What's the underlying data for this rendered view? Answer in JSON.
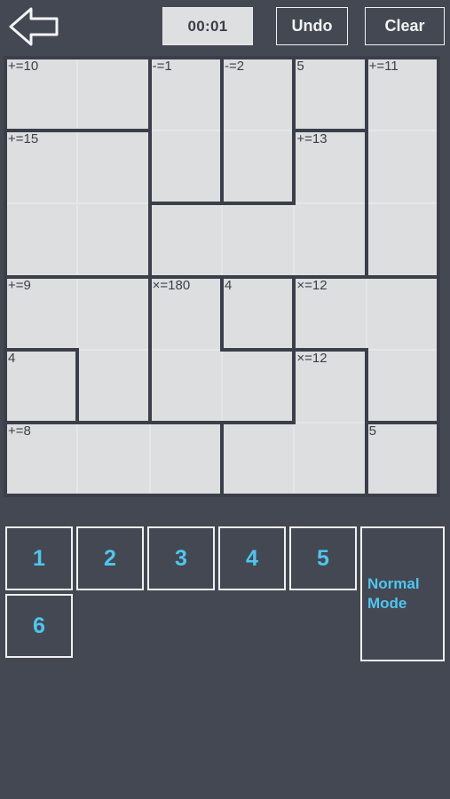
{
  "app": {
    "background_color": "#434853",
    "cell_color": "#dcdee0",
    "cage_border_color": "#3b3f49",
    "accent_color": "#4fc6ee"
  },
  "topbar": {
    "back_icon": "back-arrow-icon",
    "timer": "00:01",
    "undo_label": "Undo",
    "clear_label": "Clear"
  },
  "puzzle": {
    "size": 6,
    "rows": 6,
    "cols": 6,
    "cells": [
      {
        "r": 0,
        "c": 0,
        "clue": "+=10",
        "value": ""
      },
      {
        "r": 0,
        "c": 1,
        "clue": "",
        "value": ""
      },
      {
        "r": 0,
        "c": 2,
        "clue": "-=1",
        "value": ""
      },
      {
        "r": 0,
        "c": 3,
        "clue": "-=2",
        "value": ""
      },
      {
        "r": 0,
        "c": 4,
        "clue": "5",
        "value": ""
      },
      {
        "r": 0,
        "c": 5,
        "clue": "+=11",
        "value": ""
      },
      {
        "r": 1,
        "c": 0,
        "clue": "+=15",
        "value": ""
      },
      {
        "r": 1,
        "c": 1,
        "clue": "",
        "value": ""
      },
      {
        "r": 1,
        "c": 2,
        "clue": "",
        "value": ""
      },
      {
        "r": 1,
        "c": 3,
        "clue": "",
        "value": ""
      },
      {
        "r": 1,
        "c": 4,
        "clue": "+=13",
        "value": ""
      },
      {
        "r": 1,
        "c": 5,
        "clue": "",
        "value": ""
      },
      {
        "r": 2,
        "c": 0,
        "clue": "",
        "value": ""
      },
      {
        "r": 2,
        "c": 1,
        "clue": "",
        "value": ""
      },
      {
        "r": 2,
        "c": 2,
        "clue": "",
        "value": ""
      },
      {
        "r": 2,
        "c": 3,
        "clue": "",
        "value": ""
      },
      {
        "r": 2,
        "c": 4,
        "clue": "",
        "value": ""
      },
      {
        "r": 2,
        "c": 5,
        "clue": "",
        "value": ""
      },
      {
        "r": 3,
        "c": 0,
        "clue": "+=9",
        "value": ""
      },
      {
        "r": 3,
        "c": 1,
        "clue": "",
        "value": ""
      },
      {
        "r": 3,
        "c": 2,
        "clue": "×=180",
        "value": ""
      },
      {
        "r": 3,
        "c": 3,
        "clue": "4",
        "value": ""
      },
      {
        "r": 3,
        "c": 4,
        "clue": "×=12",
        "value": ""
      },
      {
        "r": 3,
        "c": 5,
        "clue": "",
        "value": ""
      },
      {
        "r": 4,
        "c": 0,
        "clue": "4",
        "value": ""
      },
      {
        "r": 4,
        "c": 1,
        "clue": "",
        "value": ""
      },
      {
        "r": 4,
        "c": 2,
        "clue": "",
        "value": ""
      },
      {
        "r": 4,
        "c": 3,
        "clue": "",
        "value": ""
      },
      {
        "r": 4,
        "c": 4,
        "clue": "×=12",
        "value": ""
      },
      {
        "r": 4,
        "c": 5,
        "clue": "",
        "value": ""
      },
      {
        "r": 5,
        "c": 0,
        "clue": "+=8",
        "value": ""
      },
      {
        "r": 5,
        "c": 1,
        "clue": "",
        "value": ""
      },
      {
        "r": 5,
        "c": 2,
        "clue": "",
        "value": ""
      },
      {
        "r": 5,
        "c": 3,
        "clue": "",
        "value": ""
      },
      {
        "r": 5,
        "c": 4,
        "clue": "",
        "value": ""
      },
      {
        "r": 5,
        "c": 5,
        "clue": "5",
        "value": ""
      }
    ],
    "cages": [
      {
        "clue": "+=10",
        "cells": [
          [
            0,
            0
          ],
          [
            0,
            1
          ]
        ]
      },
      {
        "clue": "-=1",
        "cells": [
          [
            0,
            2
          ],
          [
            1,
            2
          ]
        ]
      },
      {
        "clue": "-=2",
        "cells": [
          [
            0,
            3
          ],
          [
            1,
            3
          ]
        ]
      },
      {
        "clue": "5",
        "cells": [
          [
            0,
            4
          ]
        ]
      },
      {
        "clue": "+=11",
        "cells": [
          [
            0,
            5
          ],
          [
            1,
            5
          ],
          [
            2,
            5
          ]
        ]
      },
      {
        "clue": "+=15",
        "cells": [
          [
            1,
            0
          ],
          [
            1,
            1
          ],
          [
            2,
            0
          ],
          [
            2,
            1
          ]
        ]
      },
      {
        "clue": "+=13",
        "cells": [
          [
            1,
            4
          ],
          [
            2,
            2
          ],
          [
            2,
            3
          ],
          [
            2,
            4
          ]
        ]
      },
      {
        "clue": "+=9",
        "cells": [
          [
            3,
            0
          ],
          [
            3,
            1
          ],
          [
            4,
            1
          ]
        ]
      },
      {
        "clue": "×=180",
        "cells": [
          [
            3,
            2
          ],
          [
            4,
            2
          ],
          [
            4,
            3
          ]
        ]
      },
      {
        "clue": "4",
        "cells": [
          [
            3,
            3
          ]
        ]
      },
      {
        "clue": "×=12",
        "cells": [
          [
            3,
            4
          ],
          [
            3,
            5
          ],
          [
            4,
            5
          ]
        ]
      },
      {
        "clue": "4",
        "cells": [
          [
            4,
            0
          ]
        ]
      },
      {
        "clue": "×=12",
        "cells": [
          [
            4,
            4
          ],
          [
            5,
            3
          ],
          [
            5,
            4
          ]
        ]
      },
      {
        "clue": "+=8",
        "cells": [
          [
            5,
            0
          ],
          [
            5,
            1
          ],
          [
            5,
            2
          ]
        ]
      },
      {
        "clue": "5",
        "cells": [
          [
            5,
            5
          ]
        ]
      }
    ]
  },
  "pad": {
    "numbers": [
      "1",
      "2",
      "3",
      "4",
      "5",
      "6"
    ],
    "mode_label": "Normal\nMode"
  }
}
